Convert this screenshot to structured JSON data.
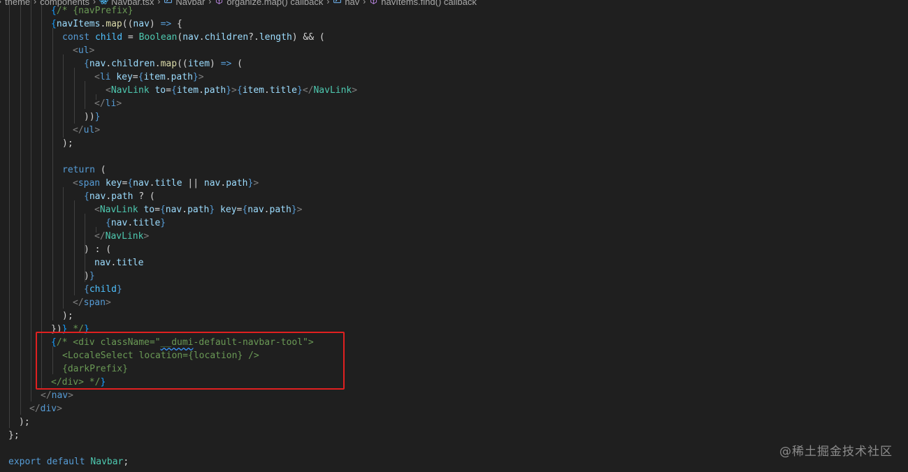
{
  "breadcrumb": {
    "items": [
      {
        "label": "theme",
        "icon": "none"
      },
      {
        "label": "components",
        "icon": "none"
      },
      {
        "label": "Navbar.tsx",
        "icon": "react-icon"
      },
      {
        "label": "Navbar",
        "icon": "variable-icon"
      },
      {
        "label": "organize.map() callback",
        "icon": "method-icon"
      },
      {
        "label": "nav",
        "icon": "variable-icon"
      },
      {
        "label": "navItems.find() callback",
        "icon": "method-icon"
      }
    ]
  },
  "code": {
    "lines": [
      "{/* {navPrefix}",
      "{navItems.map((nav) => {",
      "const child = Boolean(nav.children?.length) && (",
      "<ul>",
      "{nav.children.map((item) => (",
      "<li key={item.path}>",
      "<NavLink to={item.path}>{item.title}</NavLink>",
      "</li>",
      "))}",
      "</ul>",
      ");",
      "",
      "return (",
      "<span key={nav.title || nav.path}>",
      "{nav.path ? (",
      "<NavLink to={nav.path} key={nav.path}>",
      "{nav.title}",
      "</NavLink>",
      ") : (",
      "nav.title",
      ")}",
      "{child}",
      "</span>",
      ");",
      "})} */}",
      "{/* <div className=\"__dumi-default-navbar-tool\">",
      "<LocaleSelect location={location} />",
      "{darkPrefix}",
      "</div> */}",
      "</nav>",
      "</div>",
      ");",
      "};",
      "",
      "export default Navbar;"
    ]
  },
  "watermark": "@稀土掘金技术社区",
  "colors": {
    "background": "#1f1f1f",
    "comment": "#6a9955",
    "keyword": "#569cd6",
    "highlight_box": "#e02020"
  }
}
